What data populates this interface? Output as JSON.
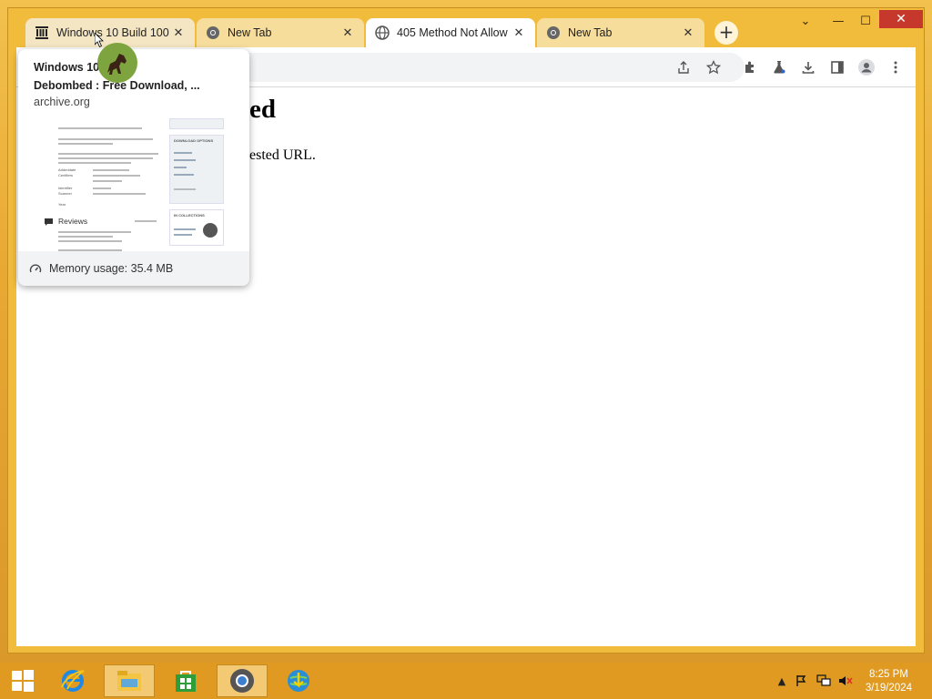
{
  "browser": {
    "tabs": [
      {
        "title": "Windows 10 Build 100",
        "icon": "archive-icon",
        "active": false
      },
      {
        "title": "New Tab",
        "icon": "chrome-icon",
        "active": false
      },
      {
        "title": "405 Method Not Allow",
        "icon": "globe-icon",
        "active": true
      },
      {
        "title": "New Tab",
        "icon": "chrome-icon",
        "active": false
      }
    ],
    "new_tab_label": "+",
    "close_glyph": "✕"
  },
  "window_controls": {
    "tab_search": "⌄",
    "minimize": "—",
    "maximize": "☐",
    "close": "✕"
  },
  "page": {
    "heading": "ed",
    "text": "ested URL."
  },
  "hover_card": {
    "title": "Windows 10 Build 10009 Debombed : Free Download, ...",
    "title_visible_line1": "Windows 10          10009",
    "title_visible_line2": "Debombed : Free Download, ...",
    "domain": "archive.org",
    "memory": "Memory usage: 35.4 MB",
    "preview": {
      "reviews_label": "Reviews",
      "sidebar_header": "DOWNLOAD OPTIONS",
      "collections_header": "IN COLLECTIONS",
      "meta_rows": [
        "Addeddate",
        "Certifiers",
        "Identifier",
        "Scanner",
        "Year"
      ]
    }
  },
  "taskbar": {
    "apps": [
      "start-button",
      "internet-explorer",
      "file-explorer",
      "store",
      "chrome",
      "internet-download-manager"
    ],
    "time": "8:25 PM",
    "date": "3/19/2024"
  },
  "colors": {
    "desktop": "#e8a832",
    "frame": "#f1bb3b",
    "tab_inactive": "#f7dd9c",
    "tab_active": "#ffffff",
    "close_red": "#c7382c"
  }
}
